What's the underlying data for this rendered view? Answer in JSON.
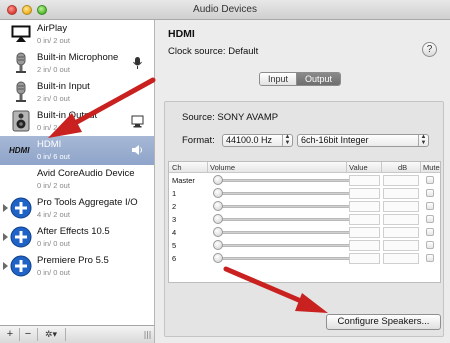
{
  "window": {
    "title": "Audio Devices"
  },
  "sidebar": {
    "devices": [
      {
        "name": "AirPlay",
        "io": "0 in/ 2 out",
        "icon": "airplay-icon"
      },
      {
        "name": "Built-in Microphone",
        "io": "2 in/ 0 out",
        "icon": "microphone-icon"
      },
      {
        "name": "Built-in Input",
        "io": "2 in/ 0 out",
        "icon": "microphone-icon"
      },
      {
        "name": "Built-in Output",
        "io": "0 in/ 2 out",
        "icon": "speaker-icon"
      },
      {
        "name": "HDMI",
        "io": "0 in/ 6 out",
        "icon": "hdmi-icon",
        "selected": true
      },
      {
        "name": "Avid CoreAudio Device",
        "io": "0 in/ 2 out",
        "icon": "none"
      },
      {
        "name": "Pro Tools Aggregate I/O",
        "io": "4 in/ 2 out",
        "icon": "aggregate-plus-icon"
      },
      {
        "name": "After Effects 10.5",
        "io": "0 in/ 0 out",
        "icon": "aggregate-plus-icon"
      },
      {
        "name": "Premiere Pro 5.5",
        "io": "0 in/ 0 out",
        "icon": "aggregate-plus-icon"
      }
    ],
    "toolbar": {
      "add": "+",
      "remove": "−",
      "gear": "✲▾"
    }
  },
  "main": {
    "device_title": "HDMI",
    "clock_source_label": "Clock source:",
    "clock_source_value": "Default",
    "help": "?",
    "tabs": {
      "input": "Input",
      "output": "Output",
      "selected": "output"
    },
    "source_label": "Source:",
    "source_value": "SONY AVAMP",
    "format_label": "Format:",
    "sample_rate": "44100.0 Hz",
    "bit_format": "6ch-16bit Integer",
    "table": {
      "headers": {
        "ch": "Ch",
        "volume": "Volume",
        "value": "Value",
        "db": "dB",
        "mute": "Mute"
      },
      "rows": [
        {
          "ch": "Master"
        },
        {
          "ch": "1"
        },
        {
          "ch": "2"
        },
        {
          "ch": "3"
        },
        {
          "ch": "4"
        },
        {
          "ch": "5"
        },
        {
          "ch": "6"
        }
      ]
    },
    "configure_button": "Configure Speakers..."
  },
  "colors": {
    "arrow": "#c8211f",
    "selection": "#8ea4c9"
  }
}
